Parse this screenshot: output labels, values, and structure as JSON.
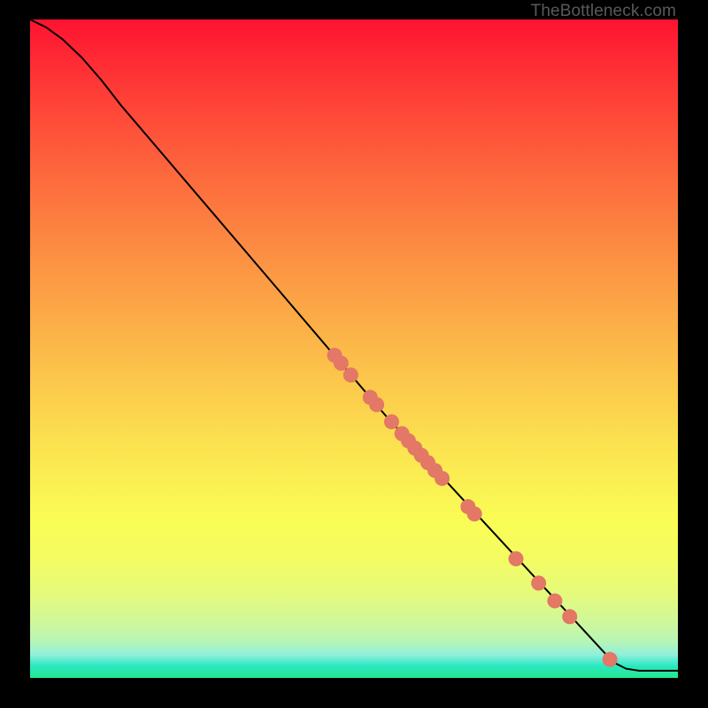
{
  "watermark": "TheBottleneck.com",
  "chart_data": {
    "type": "line",
    "title": "",
    "xlabel": "",
    "ylabel": "",
    "xlim": [
      0,
      100
    ],
    "ylim": [
      0,
      100
    ],
    "gradient_stops": [
      {
        "c": "#fe1330",
        "p": 0.0
      },
      {
        "c": "#fe3936",
        "p": 0.1
      },
      {
        "c": "#fd6a3d",
        "p": 0.24
      },
      {
        "c": "#fc9644",
        "p": 0.38
      },
      {
        "c": "#fcbf4a",
        "p": 0.52
      },
      {
        "c": "#fbe350",
        "p": 0.65
      },
      {
        "c": "#fafd55",
        "p": 0.76
      },
      {
        "c": "#f3fc62",
        "p": 0.82
      },
      {
        "c": "#e6fa7a",
        "p": 0.87
      },
      {
        "c": "#d3f896",
        "p": 0.91
      },
      {
        "c": "#b7f5b7",
        "p": 0.945
      },
      {
        "c": "#8ff0dc",
        "p": 0.965
      },
      {
        "c": "#29e8c0",
        "p": 0.982
      },
      {
        "c": "#25e790",
        "p": 1.0
      }
    ],
    "curve": [
      {
        "x": 0.0,
        "y": 100.0
      },
      {
        "x": 2.5,
        "y": 98.8
      },
      {
        "x": 5.0,
        "y": 97.0
      },
      {
        "x": 8.0,
        "y": 94.2
      },
      {
        "x": 11.0,
        "y": 90.8
      },
      {
        "x": 14.0,
        "y": 87.0
      },
      {
        "x": 55.0,
        "y": 39.7
      },
      {
        "x": 90.0,
        "y": 2.4
      },
      {
        "x": 92.0,
        "y": 1.4
      },
      {
        "x": 94.0,
        "y": 1.1
      },
      {
        "x": 100.0,
        "y": 1.1
      }
    ],
    "markers": [
      {
        "x": 47.0,
        "y": 49.0
      },
      {
        "x": 48.0,
        "y": 47.8
      },
      {
        "x": 49.5,
        "y": 46.0
      },
      {
        "x": 52.5,
        "y": 42.6
      },
      {
        "x": 53.5,
        "y": 41.5
      },
      {
        "x": 55.8,
        "y": 38.9
      },
      {
        "x": 57.4,
        "y": 37.1
      },
      {
        "x": 58.4,
        "y": 36.0
      },
      {
        "x": 59.4,
        "y": 34.9
      },
      {
        "x": 60.4,
        "y": 33.8
      },
      {
        "x": 61.4,
        "y": 32.7
      },
      {
        "x": 62.5,
        "y": 31.5
      },
      {
        "x": 63.6,
        "y": 30.3
      },
      {
        "x": 67.6,
        "y": 26.0
      },
      {
        "x": 68.6,
        "y": 24.9
      },
      {
        "x": 75.0,
        "y": 18.1
      },
      {
        "x": 78.5,
        "y": 14.4
      },
      {
        "x": 81.0,
        "y": 11.7
      },
      {
        "x": 83.3,
        "y": 9.3
      },
      {
        "x": 89.5,
        "y": 2.8
      }
    ],
    "marker_color": "#e27865",
    "marker_radius_px": 8.5
  }
}
